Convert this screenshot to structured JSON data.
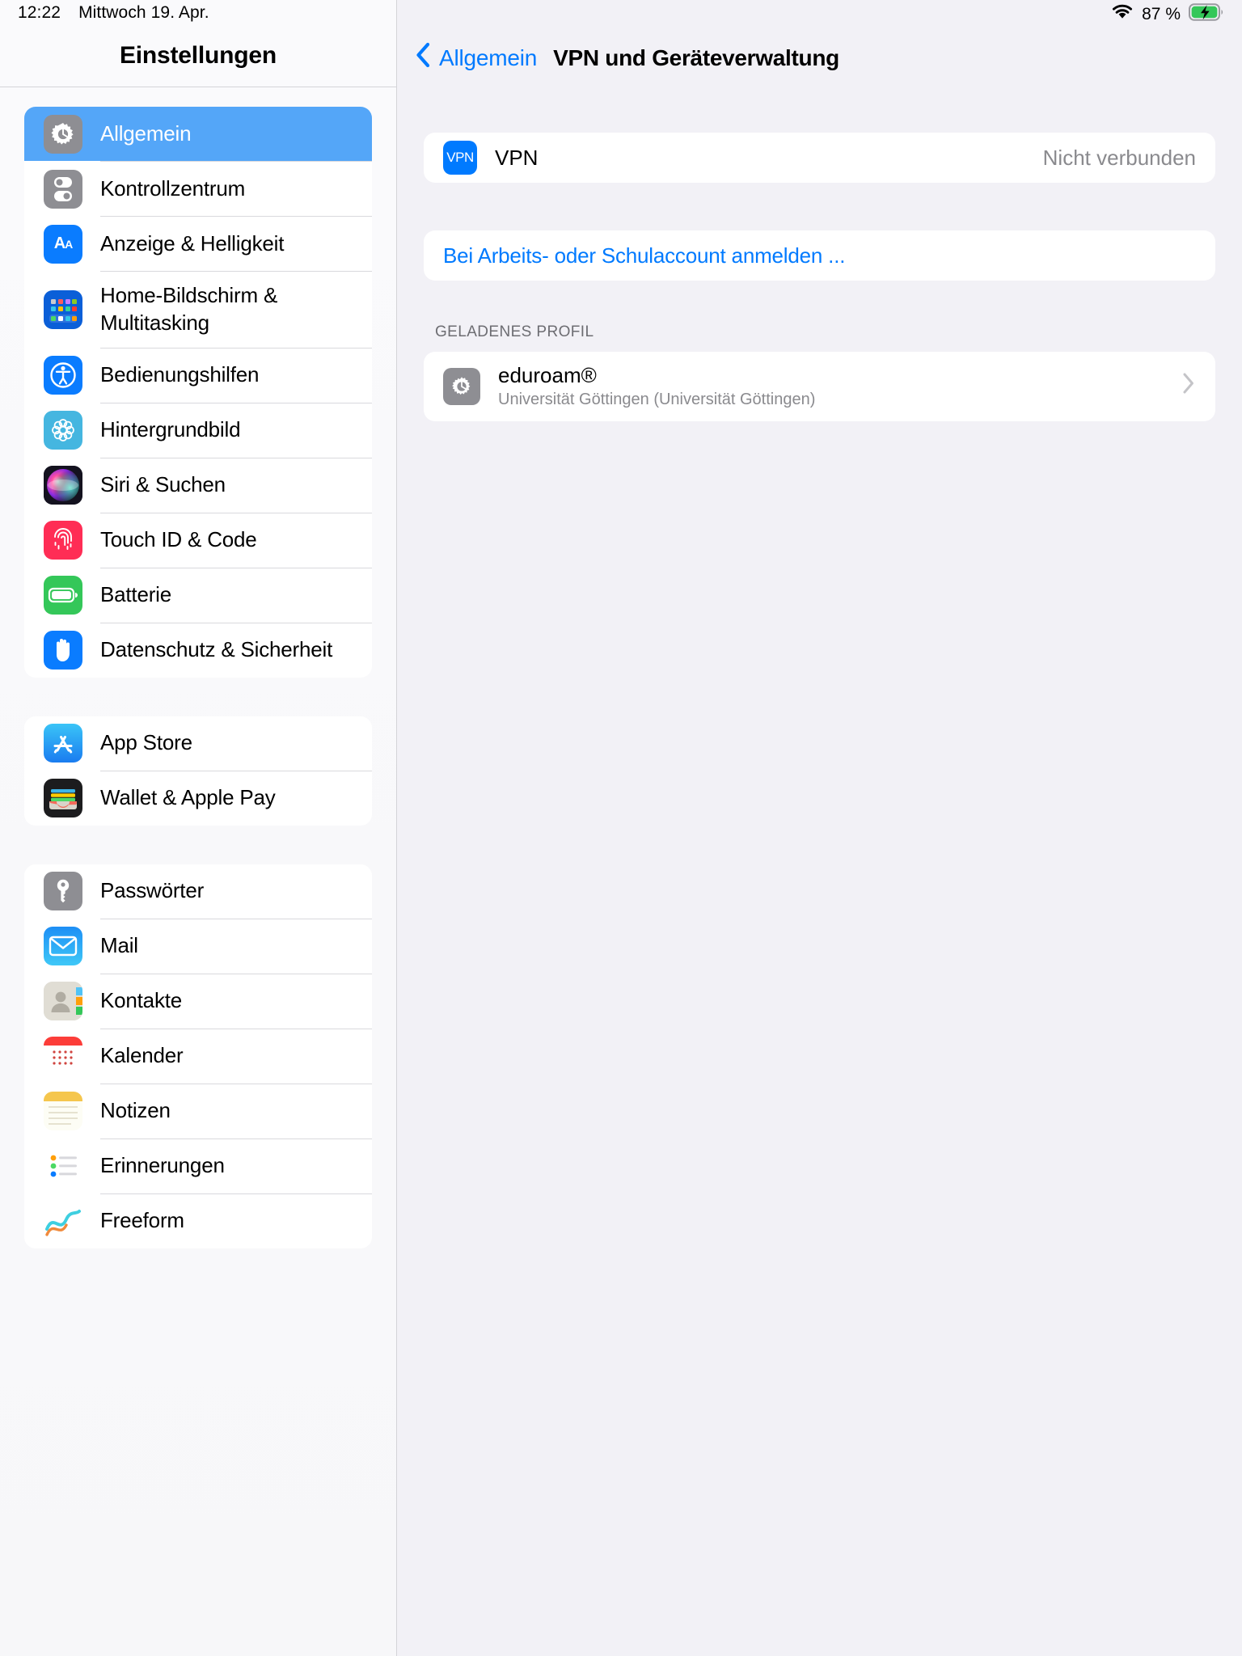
{
  "status_bar": {
    "time": "12:22",
    "date": "Mittwoch 19. Apr.",
    "battery_percent": "87 %",
    "wifi_icon": "wifi-icon",
    "battery_icon": "battery-charging-icon"
  },
  "sidebar": {
    "title": "Einstellungen",
    "groups": [
      {
        "items": [
          {
            "label": "Allgemein",
            "icon": "gear-icon",
            "selected": true
          },
          {
            "label": "Kontrollzentrum",
            "icon": "control-center-icon",
            "selected": false
          },
          {
            "label": "Anzeige & Helligkeit",
            "icon": "display-brightness-icon",
            "selected": false
          },
          {
            "label": "Home-Bildschirm & Multitasking",
            "icon": "home-screen-icon",
            "selected": false
          },
          {
            "label": "Bedienungshilfen",
            "icon": "accessibility-icon",
            "selected": false
          },
          {
            "label": "Hintergrundbild",
            "icon": "wallpaper-icon",
            "selected": false
          },
          {
            "label": "Siri & Suchen",
            "icon": "siri-icon",
            "selected": false
          },
          {
            "label": "Touch ID & Code",
            "icon": "touch-id-icon",
            "selected": false
          },
          {
            "label": "Batterie",
            "icon": "battery-icon",
            "selected": false
          },
          {
            "label": "Datenschutz & Sicherheit",
            "icon": "privacy-hand-icon",
            "selected": false
          }
        ]
      },
      {
        "items": [
          {
            "label": "App Store",
            "icon": "app-store-icon",
            "selected": false
          },
          {
            "label": "Wallet & Apple Pay",
            "icon": "wallet-icon",
            "selected": false
          }
        ]
      },
      {
        "items": [
          {
            "label": "Passwörter",
            "icon": "passwords-key-icon",
            "selected": false
          },
          {
            "label": "Mail",
            "icon": "mail-icon",
            "selected": false
          },
          {
            "label": "Kontakte",
            "icon": "contacts-icon",
            "selected": false
          },
          {
            "label": "Kalender",
            "icon": "calendar-icon",
            "selected": false
          },
          {
            "label": "Notizen",
            "icon": "notes-icon",
            "selected": false
          },
          {
            "label": "Erinnerungen",
            "icon": "reminders-icon",
            "selected": false
          },
          {
            "label": "Freeform",
            "icon": "freeform-icon",
            "selected": false
          }
        ]
      }
    ]
  },
  "detail": {
    "back_label": "Allgemein",
    "back_icon": "chevron-left-icon",
    "title": "VPN und Geräteverwaltung",
    "vpn_row": {
      "icon_text": "VPN",
      "icon": "vpn-badge-icon",
      "label": "VPN",
      "status": "Nicht verbunden"
    },
    "work_account_row": {
      "label": "Bei Arbeits- oder Schulaccount anmelden ..."
    },
    "profile_section": {
      "header": "GELADENES PROFIL",
      "profile": {
        "icon": "gear-icon",
        "name": "eduroam®",
        "subtitle": "Universität Göttingen (Universität Göttingen)",
        "chevron": "chevron-right-icon"
      }
    }
  },
  "colors": {
    "accent_blue": "#007aff",
    "selection_blue": "#54a6f8",
    "secondary_text": "#8a8a8e",
    "page_background": "#f2f1f6"
  }
}
